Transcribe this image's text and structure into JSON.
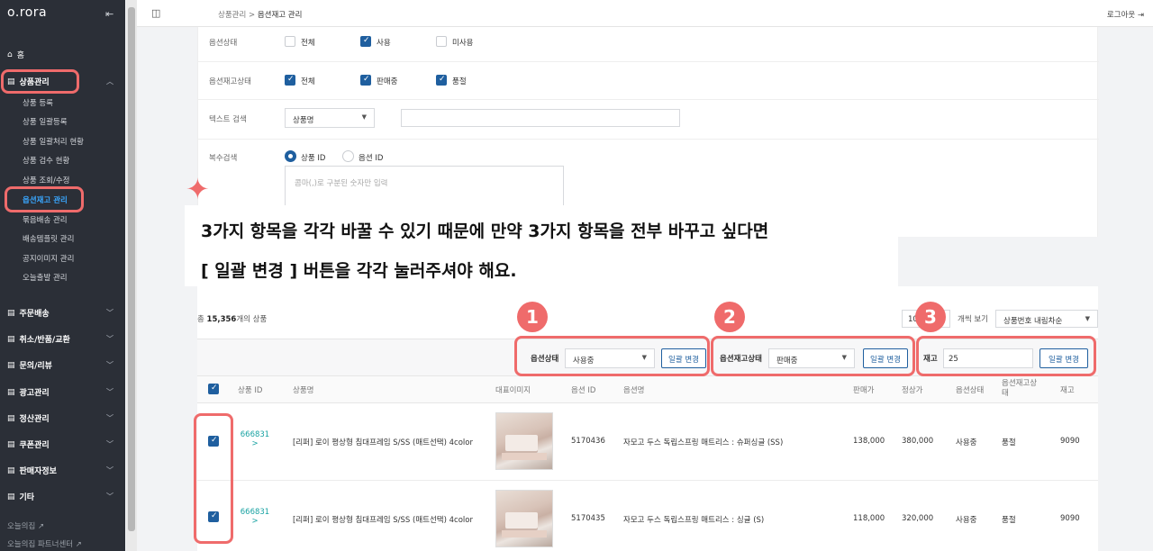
{
  "sidebar": {
    "logo": "o.rora",
    "home": "홈",
    "product_section": "상품관리",
    "product_items": [
      "상품 등록",
      "상품 일괄등록",
      "상품 일괄처리 현황",
      "상품 검수 현황",
      "상품 조회/수정",
      "옵션재고 관리",
      "묶음배송 관리",
      "배송템플릿 관리",
      "공지이미지 관리",
      "오늘출발 관리"
    ],
    "sections": [
      "주문배송",
      "취소/반품/교환",
      "문의/리뷰",
      "광고관리",
      "정산관리",
      "쿠폰관리",
      "판매자정보",
      "기타"
    ],
    "external_links": [
      "오늘의집",
      "오늘의집 파트너센터"
    ]
  },
  "topbar": {
    "breadcrumb_parent": "상품관리",
    "breadcrumb_sep": ">",
    "breadcrumb_current": "옵션재고 관리",
    "logout": "로그아웃"
  },
  "filter": {
    "option_status_label": "옵션상태",
    "option_status_options": [
      {
        "label": "전체",
        "checked": false
      },
      {
        "label": "사용",
        "checked": true
      },
      {
        "label": "미사용",
        "checked": false
      }
    ],
    "stock_status_label": "옵션재고상태",
    "stock_status_options": [
      {
        "label": "전체",
        "checked": true
      },
      {
        "label": "판매중",
        "checked": true
      },
      {
        "label": "품절",
        "checked": true
      }
    ],
    "text_search_label": "텍스트 검색",
    "text_search_select": "상품명",
    "multi_search_label": "복수검색",
    "multi_search_radio": [
      {
        "label": "상품 ID",
        "checked": true
      },
      {
        "label": "옵션 ID",
        "checked": false
      }
    ],
    "multi_search_placeholder": "콤마(,)로 구분된 숫자만 입력"
  },
  "annotation": {
    "line1": "3가지 항목을 각각 바꿀 수 있기 때문에 만약 3가지 항목을 전부 바꾸고 싶다면",
    "line2": "[ 일괄 변경 ] 버튼을 각각 눌러주셔야 해요."
  },
  "results": {
    "total_prefix": "총",
    "total_count": "15,356",
    "total_suffix": "개의 상품",
    "page_size": "10",
    "view_label": "개씩 보기",
    "sort": "상품번호 내림차순"
  },
  "bulk": {
    "option_status_label": "옵션상태",
    "option_status_value": "사용중",
    "stock_status_label": "옵션재고상태",
    "stock_status_value": "판매중",
    "stock_label": "재고",
    "stock_value": "25",
    "apply_label": "일괄 변경",
    "badges": [
      "1",
      "2",
      "3"
    ]
  },
  "table": {
    "headers": [
      "상품 ID",
      "상품명",
      "대표이미지",
      "옵션 ID",
      "옵션명",
      "판매가",
      "정상가",
      "옵션상태",
      "옵션재고상태",
      "재고"
    ],
    "rows": [
      {
        "product_id": "666831",
        "name": "[리퍼] 로이 평상형 침대프레임 S/SS (매트선택) 4color",
        "option_id": "5170436",
        "option_name": "자모고 두스 독립스프링 매트리스 : 슈퍼싱글 (SS)",
        "price": "138,000",
        "list_price": "380,000",
        "status": "사용중",
        "stock_status": "품절",
        "stock": "9090"
      },
      {
        "product_id": "666831",
        "name": "[리퍼] 로이 평상형 침대프레임 S/SS (매트선택) 4color",
        "option_id": "5170435",
        "option_name": "자모고 두스 독립스프링 매트리스 : 싱글 (S)",
        "price": "118,000",
        "list_price": "320,000",
        "status": "사용중",
        "stock_status": "품절",
        "stock": "9090"
      }
    ]
  }
}
